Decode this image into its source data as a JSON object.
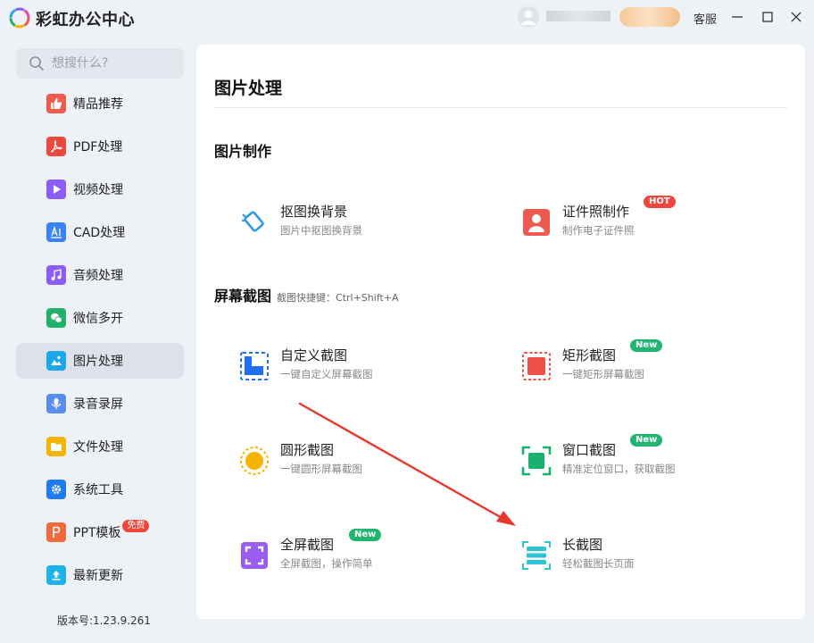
{
  "app": {
    "title": "彩虹办公中心"
  },
  "header": {
    "service_label": "客服"
  },
  "search": {
    "placeholder": "想搜什么?"
  },
  "sidebar": {
    "items": [
      {
        "label": "精品推荐",
        "icon": "thumbs-up-icon",
        "color": "#f05a4f"
      },
      {
        "label": "PDF处理",
        "icon": "pdf-icon",
        "color": "#ea4a3f"
      },
      {
        "label": "视频处理",
        "icon": "play-icon",
        "color": "#8b5cf6"
      },
      {
        "label": "CAD处理",
        "icon": "cad-icon",
        "color": "#3b82f6"
      },
      {
        "label": "音频处理",
        "icon": "music-icon",
        "color": "#8b5cf6"
      },
      {
        "label": "微信多开",
        "icon": "wechat-icon",
        "color": "#22b06a"
      },
      {
        "label": "图片处理",
        "icon": "image-icon",
        "color": "#1ea7e8"
      },
      {
        "label": "录音录屏",
        "icon": "microphone-icon",
        "color": "#5b8def"
      },
      {
        "label": "文件处理",
        "icon": "folder-icon",
        "color": "#f5b400"
      },
      {
        "label": "系统工具",
        "icon": "gear-icon",
        "color": "#1f7bf0"
      },
      {
        "label": "PPT模板",
        "icon": "ppt-icon",
        "color": "#f06a3c",
        "badge": "免费"
      },
      {
        "label": "最新更新",
        "icon": "upload-icon",
        "color": "#1fb2e8"
      }
    ],
    "active": "图片处理"
  },
  "version": "版本号:1.23.9.261",
  "main": {
    "title": "图片处理",
    "sections": [
      {
        "title": "图片制作"
      },
      {
        "title": "屏幕截图",
        "hint": "截图快捷键：Ctrl+Shift+A"
      }
    ],
    "tools": {
      "cutout": {
        "name": "抠图换背景",
        "desc": "图片中抠图换背景"
      },
      "id_photo": {
        "name": "证件照制作",
        "desc": "制作电子证件照",
        "tag": "HOT"
      },
      "custom_shot": {
        "name": "自定义截图",
        "desc": "一键自定义屏幕截图"
      },
      "rect_shot": {
        "name": "矩形截图",
        "desc": "一键矩形屏幕截图",
        "tag": "New"
      },
      "circle_shot": {
        "name": "圆形截图",
        "desc": "一键圆形屏幕截图"
      },
      "window_shot": {
        "name": "窗口截图",
        "desc": "精准定位窗口，获取截图",
        "tag": "New"
      },
      "full_shot": {
        "name": "全屏截图",
        "desc": "全屏截图，操作简单",
        "tag": "New"
      },
      "long_shot": {
        "name": "长截图",
        "desc": "轻松截图长页面"
      }
    }
  },
  "colors": {
    "accent": "#1ea7e8",
    "hot": "#f0463b",
    "new": "#21b66f",
    "arrow": "#e8392f"
  }
}
